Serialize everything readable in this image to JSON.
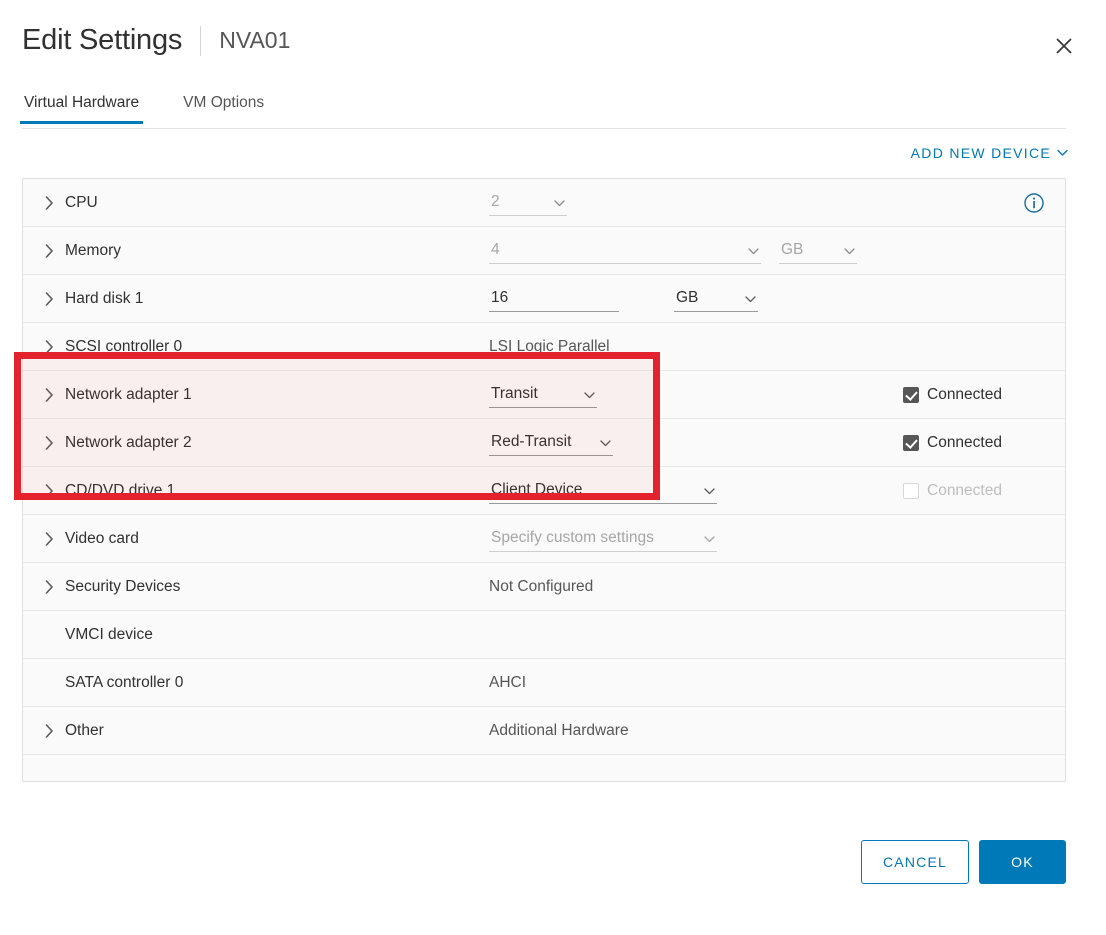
{
  "header": {
    "title": "Edit Settings",
    "subtitle": "NVA01",
    "close_label": "✕"
  },
  "tabs": [
    {
      "label": "Virtual Hardware",
      "active": true
    },
    {
      "label": "VM Options",
      "active": false
    }
  ],
  "toolbar": {
    "add_new_device": "ADD NEW DEVICE",
    "add_new_device_caret": "⌄"
  },
  "colors": {
    "accent_blue": "#0079b8",
    "highlight_red": "#e3222e",
    "text_primary": "#313131",
    "text_muted": "#a6a6a6"
  },
  "rows": {
    "cpu": {
      "label": "CPU",
      "value": "2"
    },
    "memory": {
      "label": "Memory",
      "value": "4",
      "unit": "GB"
    },
    "hard_disk": {
      "label": "Hard disk 1",
      "value": "16",
      "unit": "GB"
    },
    "scsi": {
      "label": "SCSI controller 0",
      "value": "LSI Logic Parallel"
    },
    "net1": {
      "label": "Network adapter 1",
      "value": "Transit",
      "connected": "Connected"
    },
    "net2": {
      "label": "Network adapter 2",
      "value": "Red-Transit",
      "connected": "Connected"
    },
    "cddvd": {
      "label": "CD/DVD drive 1",
      "value": "Client Device",
      "connected": "Connected"
    },
    "video": {
      "label": "Video card",
      "value": "Specify custom settings"
    },
    "security": {
      "label": "Security Devices",
      "value": "Not Configured"
    },
    "vmci": {
      "label": "VMCI device",
      "value": ""
    },
    "sata": {
      "label": "SATA controller 0",
      "value": "AHCI"
    },
    "other": {
      "label": "Other",
      "value": "Additional Hardware"
    }
  },
  "footer": {
    "cancel": "CANCEL",
    "ok": "OK"
  }
}
